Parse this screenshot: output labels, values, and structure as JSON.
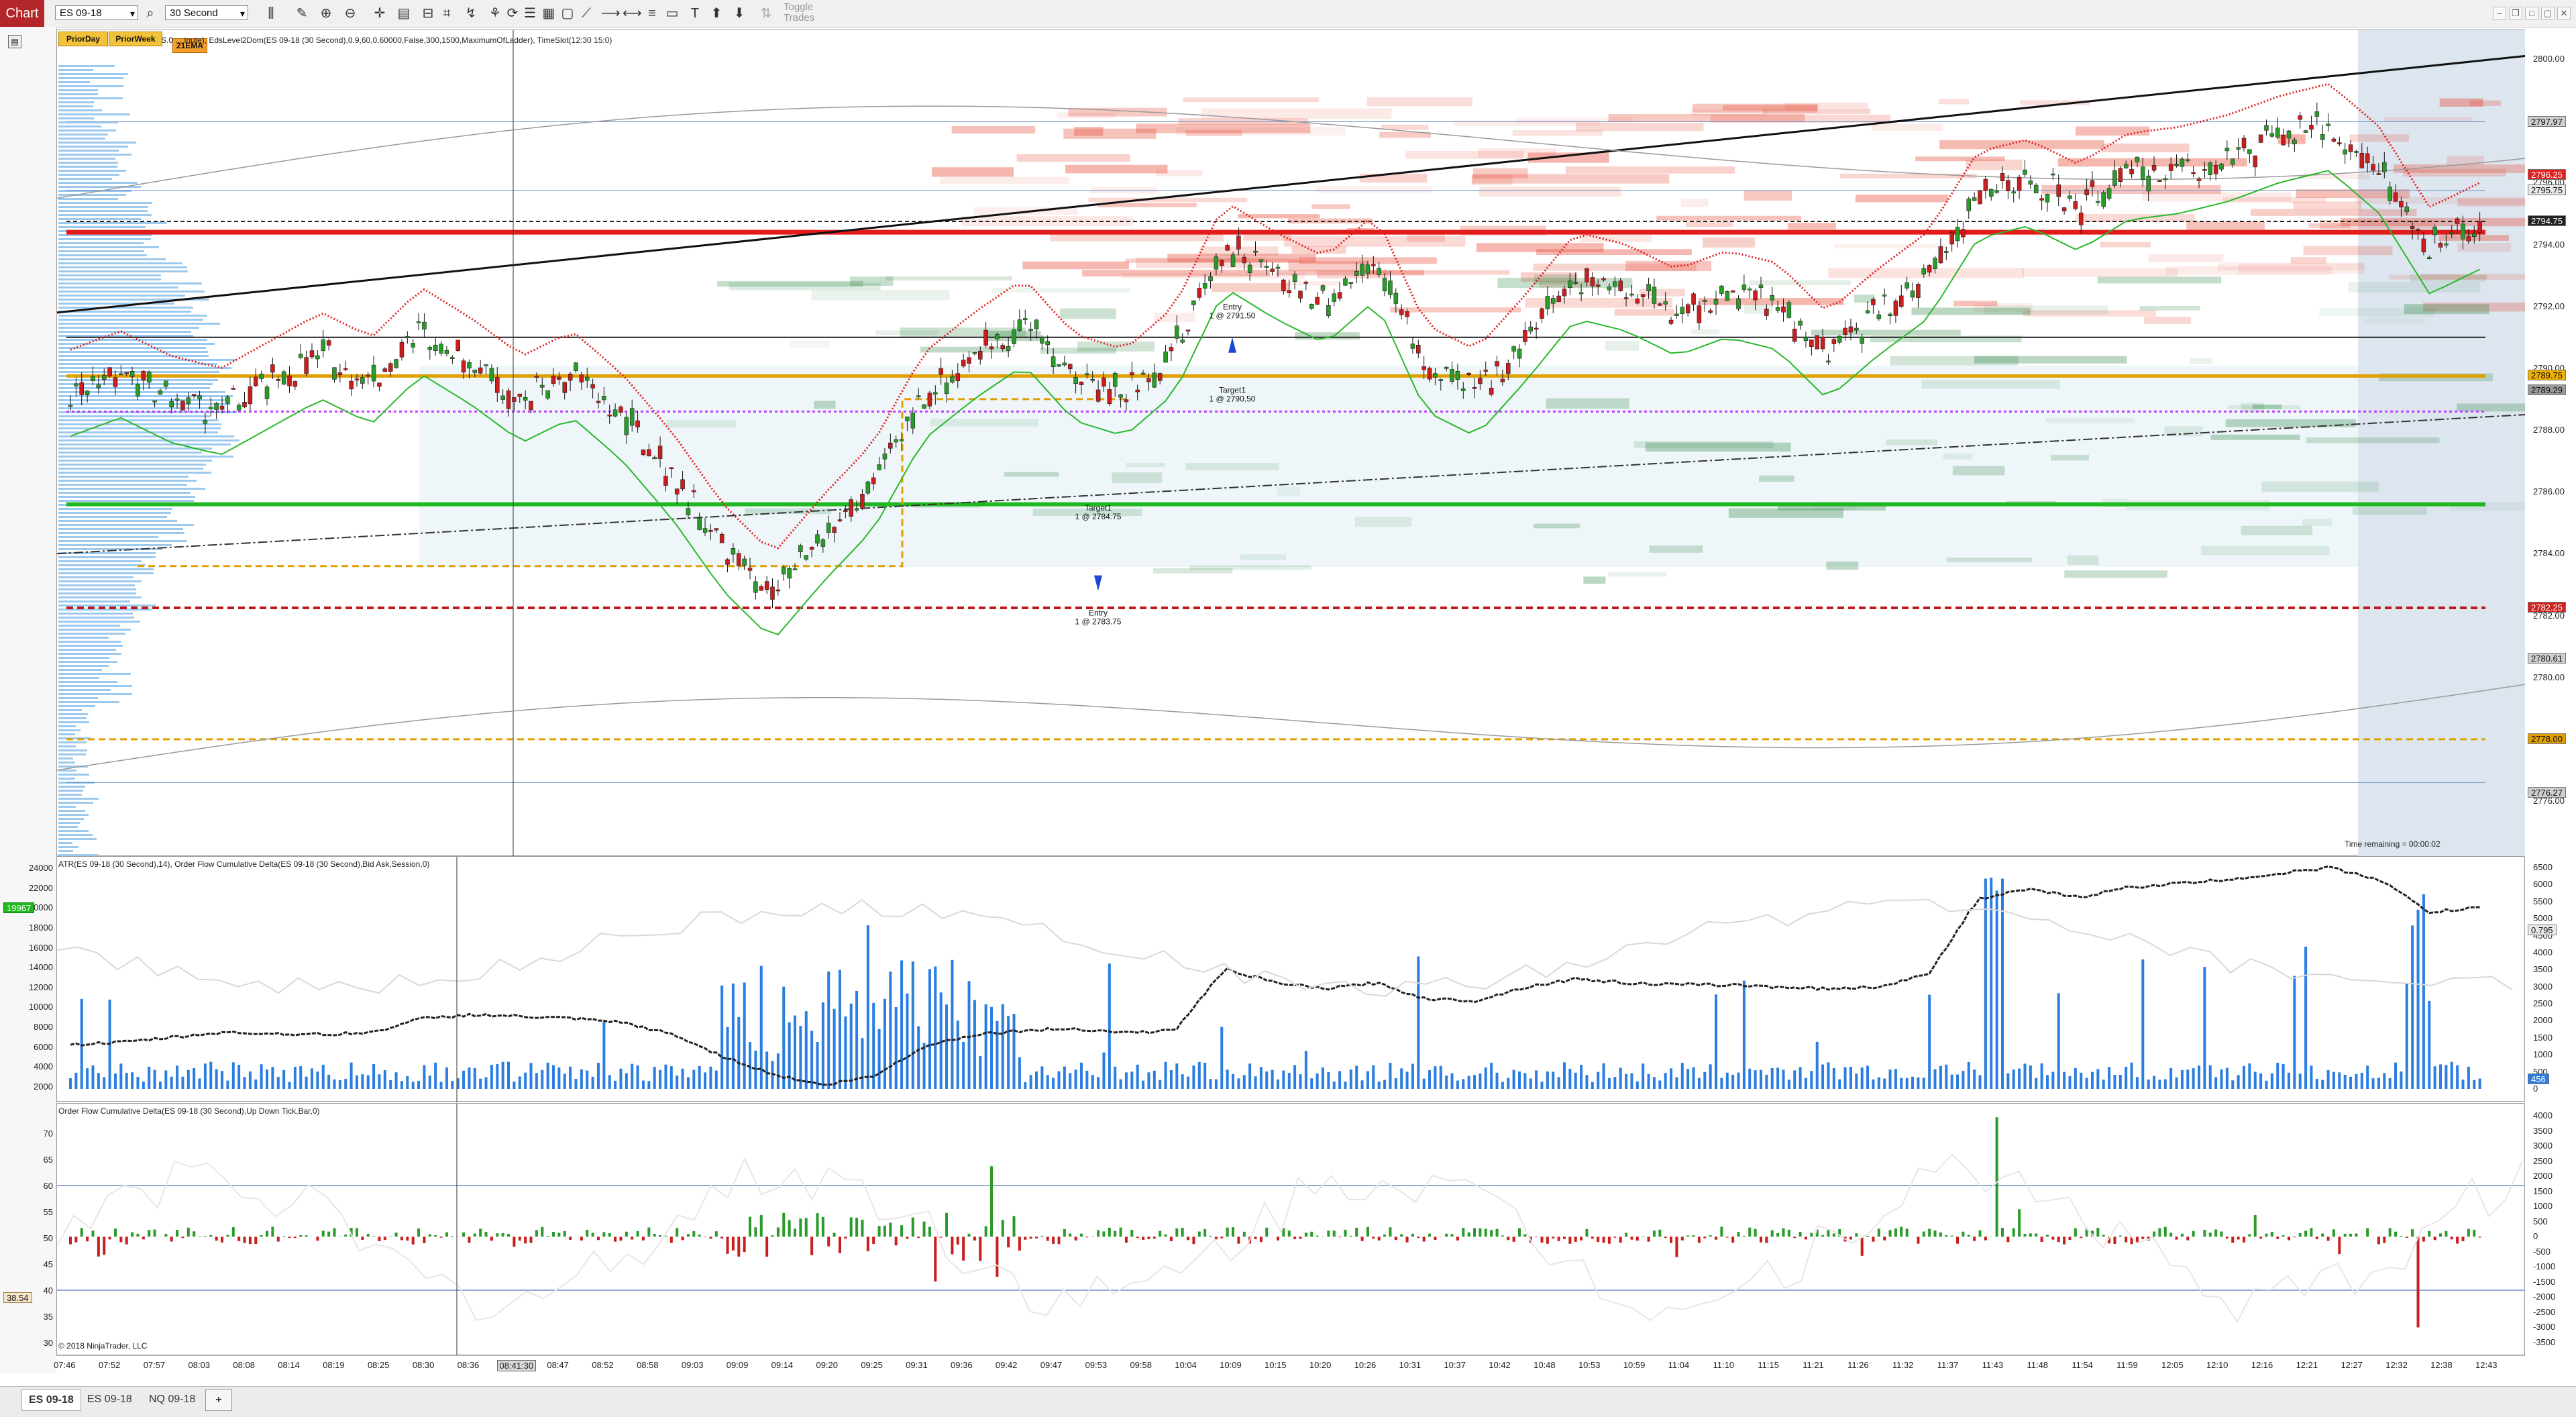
{
  "toolbar": {
    "chart_tab": "Chart",
    "instrument": "ES 09-18",
    "period": "30 Second",
    "toggle_trades": "Toggle Trades",
    "icons": [
      "search-icon",
      "bar-type-icon",
      "zoom-in-icon",
      "zoom-out-icon",
      "crosshair-icon",
      "properties-icon",
      "draw-icon",
      "chart-trader-icon",
      "data-box-icon",
      "strategies-icon",
      "indicators-icon",
      "templates-icon",
      "refresh-icon",
      "line-icon",
      "ray-icon",
      "horizontal-line-icon",
      "rectangle-icon",
      "text-icon",
      "arrow-up-icon",
      "arrow-down-icon"
    ]
  },
  "price_panel": {
    "buttons": [
      "PriorDay",
      "PriorWeek",
      "21EMA"
    ],
    "indicators_text": "S.0 ... inute), EdsLevel2Dom(ES 09-18 (30 Second),0.9,60,0,60000,False,300,1500,MaximumOfLadder), TimeSlot(12:30   15:0)",
    "axis_ticks": [
      "2800.00",
      "2798.00",
      "2796.00",
      "2794.00",
      "2792.00",
      "2790.00",
      "2788.00",
      "2786.00",
      "2784.00",
      "2782.00",
      "2780.00",
      "2778.00",
      "2776.00"
    ],
    "price_tags": [
      {
        "text": "2797.97",
        "color": "#cfcfcf"
      },
      {
        "text": "2796.25",
        "color": "#e02020"
      },
      {
        "text": "2795.75",
        "color": "#e8e8e8"
      },
      {
        "text": "2794.75",
        "color": "#222222"
      },
      {
        "text": "2789.75",
        "color": "#f0b000"
      },
      {
        "text": "2789.29",
        "color": "#9a9a9a"
      },
      {
        "text": "2782.25",
        "color": "#cc2222"
      },
      {
        "text": "2780.61",
        "color": "#cfcfcf"
      },
      {
        "text": "2778.00",
        "color": "#e0a000"
      },
      {
        "text": "2776.27",
        "color": "#cfcfcf"
      }
    ],
    "annotations": [
      {
        "lines": [
          "Entry",
          "1 @ 2791.50"
        ]
      },
      {
        "lines": [
          "Target1",
          "1 @ 2790.50"
        ]
      },
      {
        "lines": [
          "Target1",
          "1 @ 2784.75"
        ]
      },
      {
        "lines": [
          "Entry",
          "1 @ 2783.75"
        ]
      }
    ],
    "time_remaining": "Time remaining = 00:00:02"
  },
  "atr_panel": {
    "title": "ATR(ES 09-18 (30 Second),14), Order Flow Cumulative Delta(ES 09-18 (30 Second),Bid Ask,Session,0)",
    "left_ticks": [
      "24000",
      "22000",
      "20000",
      "18000",
      "16000",
      "14000",
      "12000",
      "10000",
      "8000",
      "6000",
      "4000",
      "2000"
    ],
    "left_tag": "19967",
    "right_ticks": [
      "6500",
      "6000",
      "5500",
      "5000",
      "4500",
      "4000",
      "3500",
      "3000",
      "2500",
      "2000",
      "1500",
      "1000",
      "500",
      "0"
    ],
    "right_tags": [
      {
        "text": "0.795",
        "color": "#e8e8e8"
      },
      {
        "text": "456",
        "color": "#2a7de1"
      },
      {
        "text": "5??",
        "color": "#3a3a3a"
      }
    ]
  },
  "delta_panel": {
    "title": "Order Flow Cumulative Delta(ES 09-18 (30 Second),Up Down Tick,Bar,0)",
    "left_ticks": [
      "70",
      "65",
      "60",
      "55",
      "50",
      "45",
      "40",
      "35",
      "30"
    ],
    "left_tag": "38.54",
    "right_ticks": [
      "4000",
      "3500",
      "3000",
      "2500",
      "2000",
      "1500",
      "1000",
      "500",
      "0",
      "-500",
      "-1000",
      "-1500",
      "-2000",
      "-2500",
      "-3000",
      "-3500"
    ],
    "right_tag": "???",
    "copyright": "© 2018 NinjaTrader, LLC"
  },
  "time_axis": {
    "labels": [
      "07:46",
      "07:52",
      "07:57",
      "08:03",
      "08:08",
      "08:14",
      "08:19",
      "08:25",
      "08:30",
      "08:36",
      "08:41:30",
      "08:47",
      "08:52",
      "08:58",
      "09:03",
      "09:09",
      "09:14",
      "09:20",
      "09:25",
      "09:31",
      "09:36",
      "09:42",
      "09:47",
      "09:53",
      "09:58",
      "10:04",
      "10:09",
      "10:15",
      "10:20",
      "10:26",
      "10:31",
      "10:37",
      "10:42",
      "10:48",
      "10:53",
      "10:59",
      "11:04",
      "11:10",
      "11:15",
      "11:21",
      "11:26",
      "11:32",
      "11:37",
      "11:43",
      "11:48",
      "11:54",
      "11:59",
      "12:05",
      "12:10",
      "12:16",
      "12:21",
      "12:27",
      "12:32",
      "12:38",
      "12:43"
    ],
    "highlight": "08:41:30"
  },
  "bottom_tabs": [
    "ES 09-18",
    "ES 09-18",
    "NQ 09-18",
    "+"
  ]
}
